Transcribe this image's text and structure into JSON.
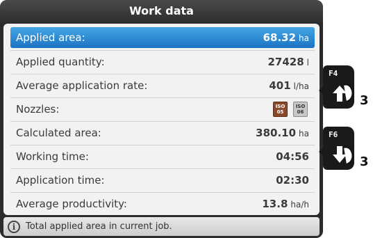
{
  "title": "Work data",
  "rows": [
    {
      "label": "Applied area:",
      "value": "68.32",
      "unit": "ha",
      "selected": true
    },
    {
      "label": "Applied quantity:",
      "value": "27428",
      "unit": "l"
    },
    {
      "label": "Average application rate:",
      "value": "401",
      "unit": "l/ha"
    },
    {
      "label": "Nozzles:",
      "nozzles": [
        {
          "line1": "ISO",
          "line2": "05",
          "color": "#8a4a2a"
        },
        {
          "line1": "ISO",
          "line2": "06",
          "color": "#c7c7c7"
        }
      ]
    },
    {
      "label": "Calculated area:",
      "value": "380.10",
      "unit": "ha"
    },
    {
      "label": "Working time:",
      "value": "04:56",
      "unit": ""
    },
    {
      "label": "Application time:",
      "value": "02:30",
      "unit": ""
    },
    {
      "label": "Average productivity:",
      "value": "13.8",
      "unit": "ha/h"
    }
  ],
  "status": {
    "icon": "info-icon",
    "text": "Total applied area in current job."
  },
  "keys": [
    {
      "label": "F4",
      "icon": "arrow-up-icon",
      "tap": "3"
    },
    {
      "label": "F6",
      "icon": "arrow-down-icon",
      "tap": "3"
    }
  ],
  "colors": {
    "selected": "#1c73c2",
    "title_bg": "#3a3a3a"
  }
}
